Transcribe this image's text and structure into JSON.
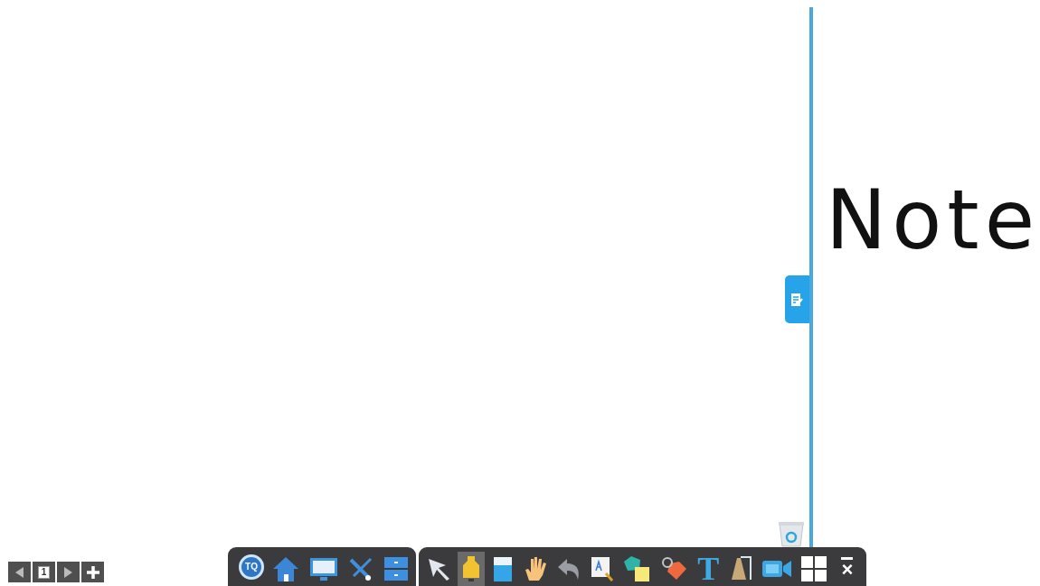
{
  "page_nav": {
    "page_number": "1"
  },
  "note_panel": {
    "handwriting": "Note"
  },
  "toolbar": {
    "left_tools": [
      {
        "kind": "logo",
        "label": "TQ"
      },
      {
        "kind": "home"
      },
      {
        "kind": "monitor"
      },
      {
        "kind": "tools"
      },
      {
        "kind": "drawer"
      }
    ],
    "right_tools": [
      {
        "kind": "select",
        "selected": false
      },
      {
        "kind": "highlighter",
        "selected": true
      },
      {
        "kind": "eraser",
        "selected": false
      },
      {
        "kind": "hand",
        "selected": false
      },
      {
        "kind": "undo",
        "selected": false
      },
      {
        "kind": "recognize",
        "selected": false
      },
      {
        "kind": "shapes",
        "selected": false
      },
      {
        "kind": "tag",
        "selected": false
      },
      {
        "kind": "text",
        "label": "T",
        "selected": false
      },
      {
        "kind": "spotlight",
        "selected": false
      },
      {
        "kind": "camera",
        "selected": false
      },
      {
        "kind": "grid",
        "selected": false
      },
      {
        "kind": "close",
        "label": "×",
        "selected": false
      }
    ]
  }
}
